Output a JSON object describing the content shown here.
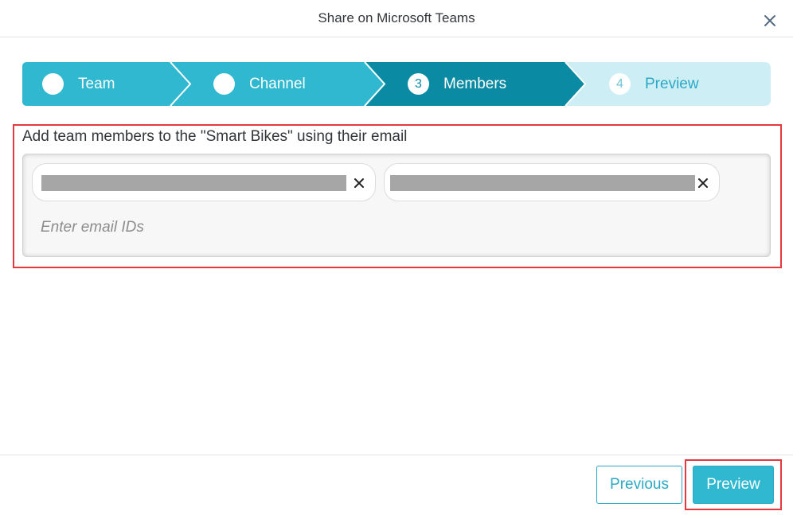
{
  "dialog": {
    "title": "Share on Microsoft Teams"
  },
  "wizard": {
    "steps": [
      {
        "number": "",
        "label": "Team",
        "state": "completed",
        "icon": "check-icon"
      },
      {
        "number": "",
        "label": "Channel",
        "state": "completed",
        "icon": "check-icon"
      },
      {
        "number": "3",
        "label": "Members",
        "state": "current"
      },
      {
        "number": "4",
        "label": "Preview",
        "state": "upcoming"
      }
    ]
  },
  "members": {
    "instruction": "Add team members to the \"Smart Bikes\" using their email",
    "placeholder": "Enter email IDs",
    "tokens": [
      {
        "value": "",
        "redacted": true,
        "remove_icon": "close-icon"
      },
      {
        "value": "",
        "redacted": true,
        "remove_icon": "close-icon"
      }
    ]
  },
  "footer": {
    "previous_label": "Previous",
    "preview_label": "Preview"
  },
  "colors": {
    "step_completed": "#2fb8d0",
    "step_current": "#0a8aa3",
    "step_upcoming": "#cdeef5",
    "accent": "#2aa8c5",
    "highlight": "#e4393f"
  }
}
